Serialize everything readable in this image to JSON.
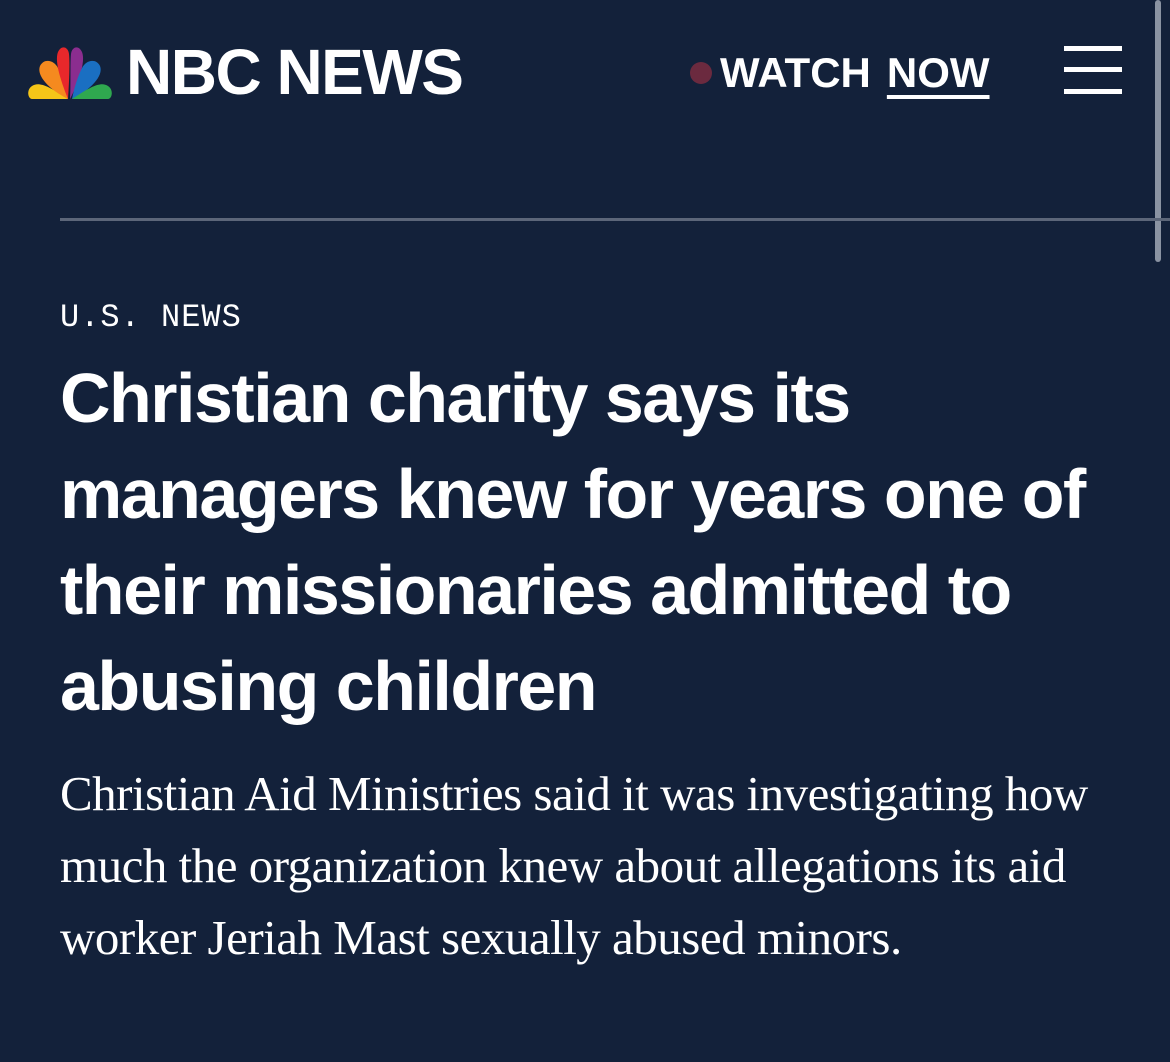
{
  "header": {
    "brand": "NBC NEWS",
    "logo_icon": "nbc-peacock-icon",
    "watch_label": "WATCH",
    "now_label": "NOW",
    "live_dot_color": "#6b2a3f",
    "menu_icon": "hamburger-menu-icon"
  },
  "article": {
    "section": "U.S. NEWS",
    "headline": "Christian charity says its managers knew for years one of their missionaries admitted to abusing children",
    "dek": "Christian Aid Ministries said it was investigating how much the organization knew about allegations its aid worker Jeriah Mast sexually abused minors."
  },
  "colors": {
    "background": "#13213a",
    "text": "#ffffff",
    "divider": "#5c6679",
    "peacock": [
      "#f5a623",
      "#e8282b",
      "#8b2d8f",
      "#1a6fc2",
      "#2fa84f",
      "#f7d417"
    ]
  }
}
